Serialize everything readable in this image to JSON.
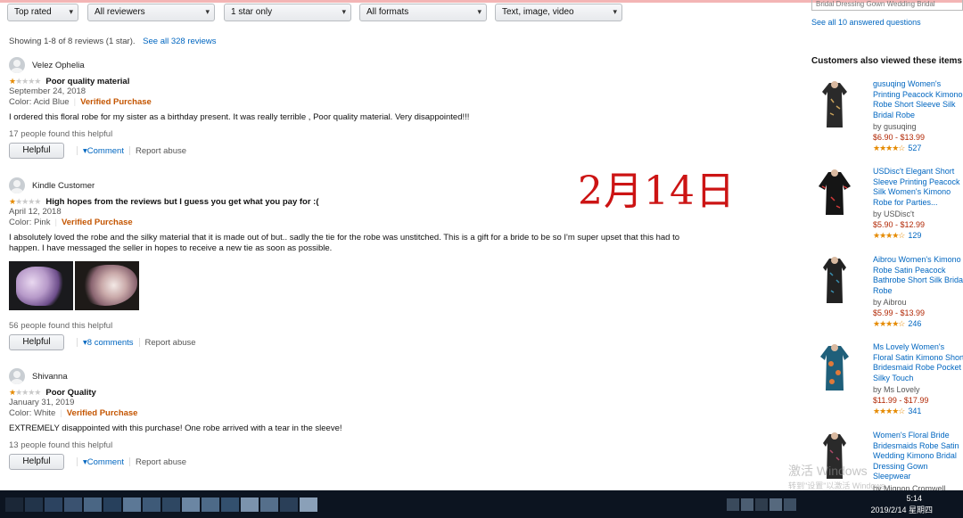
{
  "filters": [
    {
      "label": "Top rated"
    },
    {
      "label": "All reviewers"
    },
    {
      "label": "1 star only"
    },
    {
      "label": "All formats"
    },
    {
      "label": "Text, image, video"
    }
  ],
  "showing": {
    "text": "Showing 1-8 of 8 reviews (1 star).",
    "link": "See all 328 reviews"
  },
  "reviews": [
    {
      "name": "Velez Ophelia",
      "stars": "1 of 5",
      "title": "Poor quality material",
      "date": "September 24, 2018",
      "color": "Color: Acid Blue",
      "verified": "Verified Purchase",
      "body": "I ordered this floral robe for my sister as a birthday present. It was really terrible , Poor quality material. Very disappointed!!!",
      "helpful_count": "17 people found this helpful",
      "helpful_btn": "Helpful",
      "comment": "Comment",
      "report": "Report abuse"
    },
    {
      "name": "Kindle Customer",
      "stars": "1 of 5",
      "title": "High hopes from the reviews but I guess you get what you pay for :(",
      "date": "April 12, 2018",
      "color": "Color: Pink",
      "verified": "Verified Purchase",
      "body": "I absolutely loved the robe and the silky material that it is made out of but.. sadly the tie for the robe was unstitched. This is a gift for a bride to be so I'm super upset that this had to happen. I have messaged the seller in hopes to receive a new tie as soon as possible.",
      "helpful_count": "56 people found this helpful",
      "helpful_btn": "Helpful",
      "comment": "8 comments",
      "report": "Report abuse"
    },
    {
      "name": "Shivanna",
      "stars": "1 of 5",
      "title": "Poor Quality",
      "date": "January 31, 2019",
      "color": "Color: White",
      "verified": "Verified Purchase",
      "body": "EXTREMELY disappointed with this purchase! One robe arrived with a tear in the sleeve!",
      "helpful_count": "13 people found this helpful",
      "helpful_btn": "Helpful",
      "comment": "Comment",
      "report": "Report abuse"
    }
  ],
  "overlay": {
    "text": "2月14日",
    "color": "#cc1414"
  },
  "sidebar": {
    "top_input": "Bridal Dressing Gown Wedding Bridal",
    "answered_link": "See all 10 answered questions",
    "heading": "Customers also viewed these items",
    "products": [
      {
        "title": "gusuqing Women's Printing Peacock Kimono Robe Short Sleeve Silk Bridal Robe",
        "by": "by gusuqing",
        "price": "$6.90 - $13.99",
        "stars": "★★★★☆",
        "count": "527",
        "color": "#2a2a2a"
      },
      {
        "title": "USDisc't Elegant Short Sleeve Printing Peacock Silk Women's Kimono Robe for Parties...",
        "by": "by USDisc't",
        "price": "$5.90 - $12.99",
        "stars": "★★★★☆",
        "count": "129",
        "color": "#151515"
      },
      {
        "title": "Aibrou Women's Kimono Robe Satin Peacock Bathrobe Short Silk Bridal Robe",
        "by": "by Aibrou",
        "price": "$5.99 - $13.99",
        "stars": "★★★★☆",
        "count": "246",
        "color": "#222222"
      },
      {
        "title": "Ms Lovely Women's Floral Satin Kimono Short Bridesmaid Robe Pocket Silky Touch",
        "by": "by Ms Lovely",
        "price": "$11.99 - $17.99",
        "stars": "★★★★☆",
        "count": "341",
        "color": "#1f5f7a"
      },
      {
        "title": "Women's Floral Bride Bridesmaids Robe Satin Wedding Kimono Bridal Dressing Gown Sleepwear",
        "by": "by Mignon Cromwell",
        "price": "",
        "stars": "",
        "count": "",
        "color": "#2a2a2a"
      }
    ]
  },
  "watermark": {
    "line1": "激活 Windows",
    "line2": "转到\"设置\"以激活 Windows。"
  },
  "taskbar": {
    "time": "5:14",
    "date": "2019/2/14 星期四"
  }
}
